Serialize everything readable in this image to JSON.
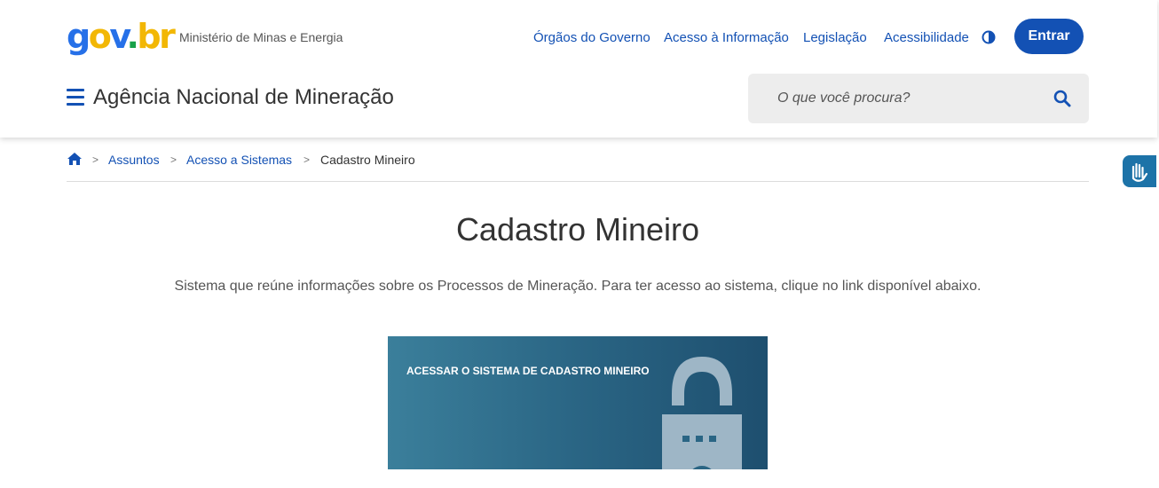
{
  "header": {
    "logo": {
      "g": "g",
      "o": "o",
      "v": "v",
      "dot": ".",
      "b": "b",
      "r": "r"
    },
    "ministry": "Ministério de Minas e Energia",
    "links": [
      "Órgãos do Governo",
      "Acesso à Informação",
      "Legislação",
      "Acessibilidade"
    ],
    "login_label": "Entrar",
    "agency": "Agência Nacional de Mineração",
    "search_placeholder": "O que você procura?"
  },
  "breadcrumb": {
    "items": [
      "Assuntos",
      "Acesso a Sistemas",
      "Cadastro Mineiro"
    ],
    "separator": ">"
  },
  "main": {
    "title": "Cadastro Mineiro",
    "description": "Sistema que reúne informações sobre os Processos de Mineração. Para ter acesso ao sistema, clique no link disponível abaixo.",
    "banner_label": "ACESSAR O SISTEMA DE CADASTRO MINEIRO"
  },
  "colors": {
    "primary": "#1351b4",
    "text": "#333333",
    "banner": "#2a6584"
  },
  "icons": [
    "contrast-icon",
    "hamburger-menu-icon",
    "search-icon",
    "home-icon",
    "vlibras-hand-icon",
    "lock-icon"
  ]
}
